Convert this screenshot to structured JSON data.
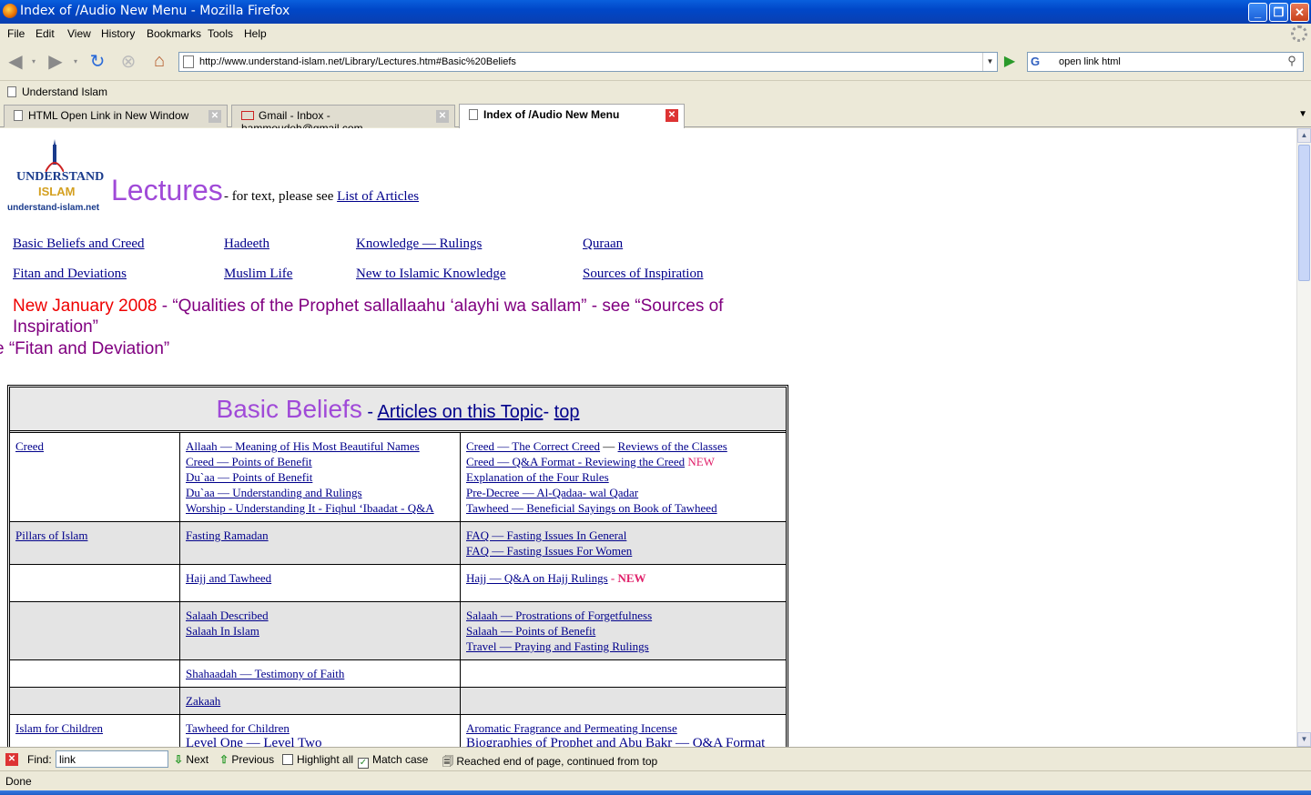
{
  "window": {
    "title": "Index of /Audio New Menu - Mozilla Firefox",
    "controls": {
      "minimize": "_",
      "maximize": "❐",
      "close": "✕"
    }
  },
  "menu": [
    "File",
    "Edit",
    "View",
    "History",
    "Bookmarks",
    "Tools",
    "Help"
  ],
  "nav": {
    "url": "http://www.understand-islam.net/Library/Lectures.htm#Basic%20Beliefs",
    "search_value": "open link html",
    "search_engine": "G"
  },
  "bookmarks": {
    "item": "Understand Islam"
  },
  "tabs": [
    {
      "label": "HTML Open Link in New Window"
    },
    {
      "label": "Gmail - Inbox - hammoudeh@gmail.com"
    },
    {
      "label": "Index of /Audio New Menu"
    }
  ],
  "page": {
    "logo": {
      "line1": "UNDERSTAND",
      "line2": "ISLAM",
      "domain": "understand-islam.net"
    },
    "title": "Lectures",
    "subtitle_prefix": "- for text, please see",
    "subtitle_link": "List of Articles",
    "nav_links": [
      "Basic Beliefs and Creed",
      "Hadeeth",
      "Knowledge — Rulings",
      "Quraan",
      "Fitan and Deviations",
      "Muslim Life",
      "New to Islamic Knowledge",
      "Sources of Inspiration"
    ],
    "new_announce": {
      "red": "New January 2008",
      "rest": " - “Qualities of the Prophet sallallaahu ‘alayhi wa sallam” - see “Sources of Inspiration”"
    },
    "marquee": "e “Fitan and Deviation”",
    "table": {
      "heading": "Basic Beliefs",
      "sep1": " - ",
      "articles_link": "Articles on this Topic",
      "sep2": "- ",
      "top_link": "top",
      "rows": [
        {
          "c1": "Creed",
          "c2": [
            "Allaah — Meaning of His Most Beautiful Names",
            "Creed — Points of Benefit",
            "Du`aa — Points of Benefit",
            "Du`aa — Understanding and Rulings",
            "Worship - Understanding It - Fiqhul ‘Ibaadat - Q&A"
          ],
          "c3": [
            "Creed — The Correct Creed",
            "Creed — Q&A Format - Reviewing the Creed",
            "Explanation of the Four Rules",
            "Pre-Decree — Al-Qadaa- wal Qadar",
            "Tawheed — Beneficial Sayings on Book of Tawheed"
          ],
          "c3_extra": {
            "reviews": "Reviews of the Classes",
            "dash": " — ",
            "new": " NEW"
          }
        },
        {
          "c1": "Pillars of Islam",
          "c2": [
            "Fasting Ramadan"
          ],
          "c3": [
            "FAQ — Fasting Issues In General",
            "FAQ — Fasting Issues For Women"
          ]
        },
        {
          "c1": "",
          "c2": [
            "Hajj and Tawheed"
          ],
          "c3": [
            "Hajj — Q&A on Hajj Rulings"
          ],
          "c3_new": " - NEW"
        },
        {
          "c1": "",
          "c2": [
            "Salaah Described",
            "Salaah In Islam"
          ],
          "c3": [
            "Salaah — Prostrations of Forgetfulness",
            "Salaah — Points of Benefit",
            "Travel — Praying and Fasting Rulings"
          ]
        },
        {
          "c1": "",
          "c2": [
            "Shahaadah — Testimony of Faith"
          ],
          "c3": []
        },
        {
          "c1": "",
          "c2": [
            "Zakaah"
          ],
          "c3": []
        },
        {
          "c1": "Islam for Children",
          "c2": [
            "Tawheed for Children",
            "Level One — Level Two"
          ],
          "c3": [
            "Aromatic Fragrance and Permeating Incense",
            "Biographies of Prophet and Abu Bakr — Q&A Format"
          ]
        }
      ]
    }
  },
  "findbar": {
    "label": "Find:",
    "value": "link",
    "next": "Next",
    "previous": "Previous",
    "highlight": "Highlight all",
    "match_case": "Match case",
    "message": "Reached end of page, continued from top"
  },
  "status": "Done"
}
